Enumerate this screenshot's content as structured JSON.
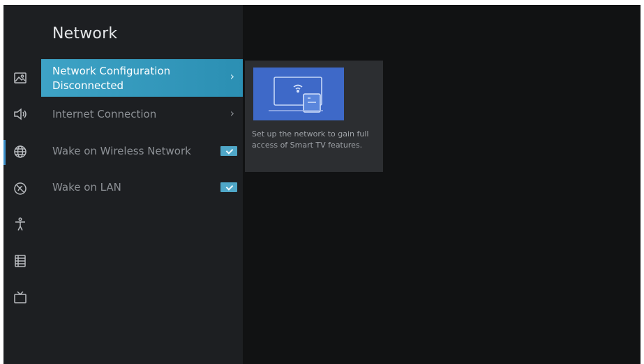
{
  "header": {
    "title": "Network"
  },
  "menu": {
    "items": [
      {
        "label": "Network Configuration",
        "sublabel": "Disconnected",
        "chevron": "›"
      },
      {
        "label": "Internet Connection",
        "chevron": "›"
      },
      {
        "label": "Wake on Wireless Network",
        "checked": true
      },
      {
        "label": "Wake on LAN",
        "checked": true
      }
    ]
  },
  "info_card": {
    "description": "Set up the network to gain full access of Smart TV features."
  },
  "sidebar": {
    "icons": [
      "picture-icon",
      "sound-icon",
      "network-icon",
      "satellite-icon",
      "accessibility-icon",
      "system-list-icon",
      "tv-icon"
    ],
    "active_index": 2
  },
  "colors": {
    "accent": "#3ea3c6",
    "checkbox": "#4fa7c8",
    "panel": "#1d1f22",
    "background": "#111213"
  }
}
